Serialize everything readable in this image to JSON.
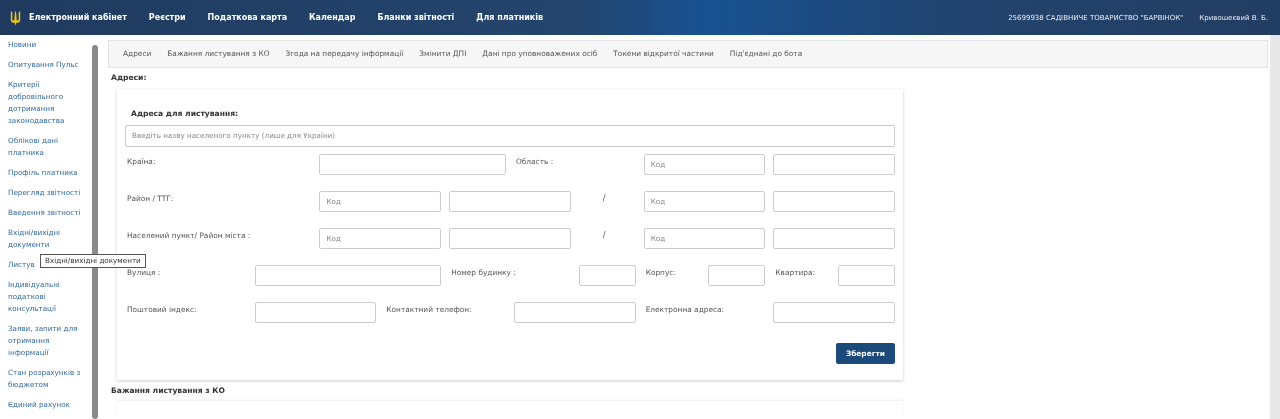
{
  "header": {
    "brand": "Електронний кабінет",
    "nav": [
      "Реєстри",
      "Податкова карта",
      "Календар",
      "Бланки звітності",
      "Для платників"
    ],
    "organization": "25699938 САДІВНИЧЕ ТОВАРИСТВО \"БАРВІНОК\"",
    "user": "Кривошеєвий В. Б."
  },
  "sidebar": {
    "items": [
      "Новини",
      "Опитування Пульс",
      "Критерії добровільного дотримання законодавства",
      "Облікові дані платника",
      "Профіль платника",
      "Перегляд звітності",
      "Введення звітності",
      "Вхідні/вихідні документи",
      "Листув",
      "Індивідуальні податкові консультації",
      "Заяви, запити для отримання інформації",
      "Стан розрахунків з бюджетом",
      "Єдиний рахунок"
    ],
    "tooltip": "Вхідні/вихідні документи"
  },
  "tabs": [
    "Адреси",
    "Бажання листування з КО",
    "Згода на передачу інформації",
    "Змінити ДПІ",
    "Дані про уповноважених осіб",
    "Токени відкритої частини",
    "Під'єднані до бота"
  ],
  "section_title": "Адреси:",
  "address_form": {
    "heading": "Адреса для листування:",
    "search": {
      "placeholder": "Введіть назву населеного пункту (лише для України)"
    },
    "rows": [
      {
        "fields": [
          {
            "kind": "label",
            "text": "Країна:"
          },
          {
            "kind": "input"
          },
          {
            "kind": "label",
            "text": "Область :"
          },
          {
            "kind": "input",
            "placeholder": "Код"
          },
          {
            "kind": "input"
          }
        ]
      },
      {
        "fields": [
          {
            "kind": "label",
            "text": "Район / ТТГ:"
          },
          {
            "kind": "input",
            "placeholder": "Код"
          },
          {
            "kind": "input"
          },
          {
            "kind": "separator",
            "text": "/"
          },
          {
            "kind": "input",
            "placeholder": "Код"
          },
          {
            "kind": "input"
          }
        ]
      },
      {
        "fields": [
          {
            "kind": "label",
            "text": "Населений пункт/ Район міста :"
          },
          {
            "kind": "input",
            "placeholder": "Код"
          },
          {
            "kind": "input"
          },
          {
            "kind": "separator",
            "text": "/"
          },
          {
            "kind": "input",
            "placeholder": "Код"
          },
          {
            "kind": "input"
          }
        ]
      },
      {
        "fields": [
          {
            "kind": "label",
            "text": "Вулиця :"
          },
          {
            "kind": "input"
          },
          {
            "kind": "label",
            "text": "Номер будинку :"
          },
          {
            "kind": "input"
          },
          {
            "kind": "label",
            "text": "Корпус:"
          },
          {
            "kind": "input"
          },
          {
            "kind": "label",
            "text": "Квартира:"
          },
          {
            "kind": "input"
          }
        ]
      },
      {
        "fields": [
          {
            "kind": "label",
            "text": "Поштовий індекс:"
          },
          {
            "kind": "input"
          },
          {
            "kind": "label",
            "text": "Контактний телефон:"
          },
          {
            "kind": "input"
          },
          {
            "kind": "label",
            "text": "Електронна адреса:"
          },
          {
            "kind": "input"
          }
        ]
      }
    ],
    "save_button": "Зберегти"
  },
  "next_section_title": "Бажання листування з КО"
}
